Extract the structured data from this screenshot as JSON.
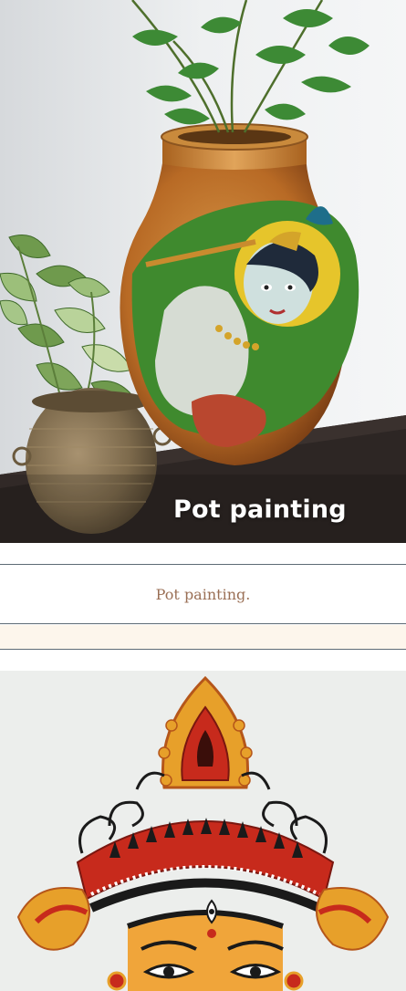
{
  "gallery": {
    "items": [
      {
        "image_overlay_text": "Pot painting",
        "caption": "Pot painting."
      }
    ]
  }
}
